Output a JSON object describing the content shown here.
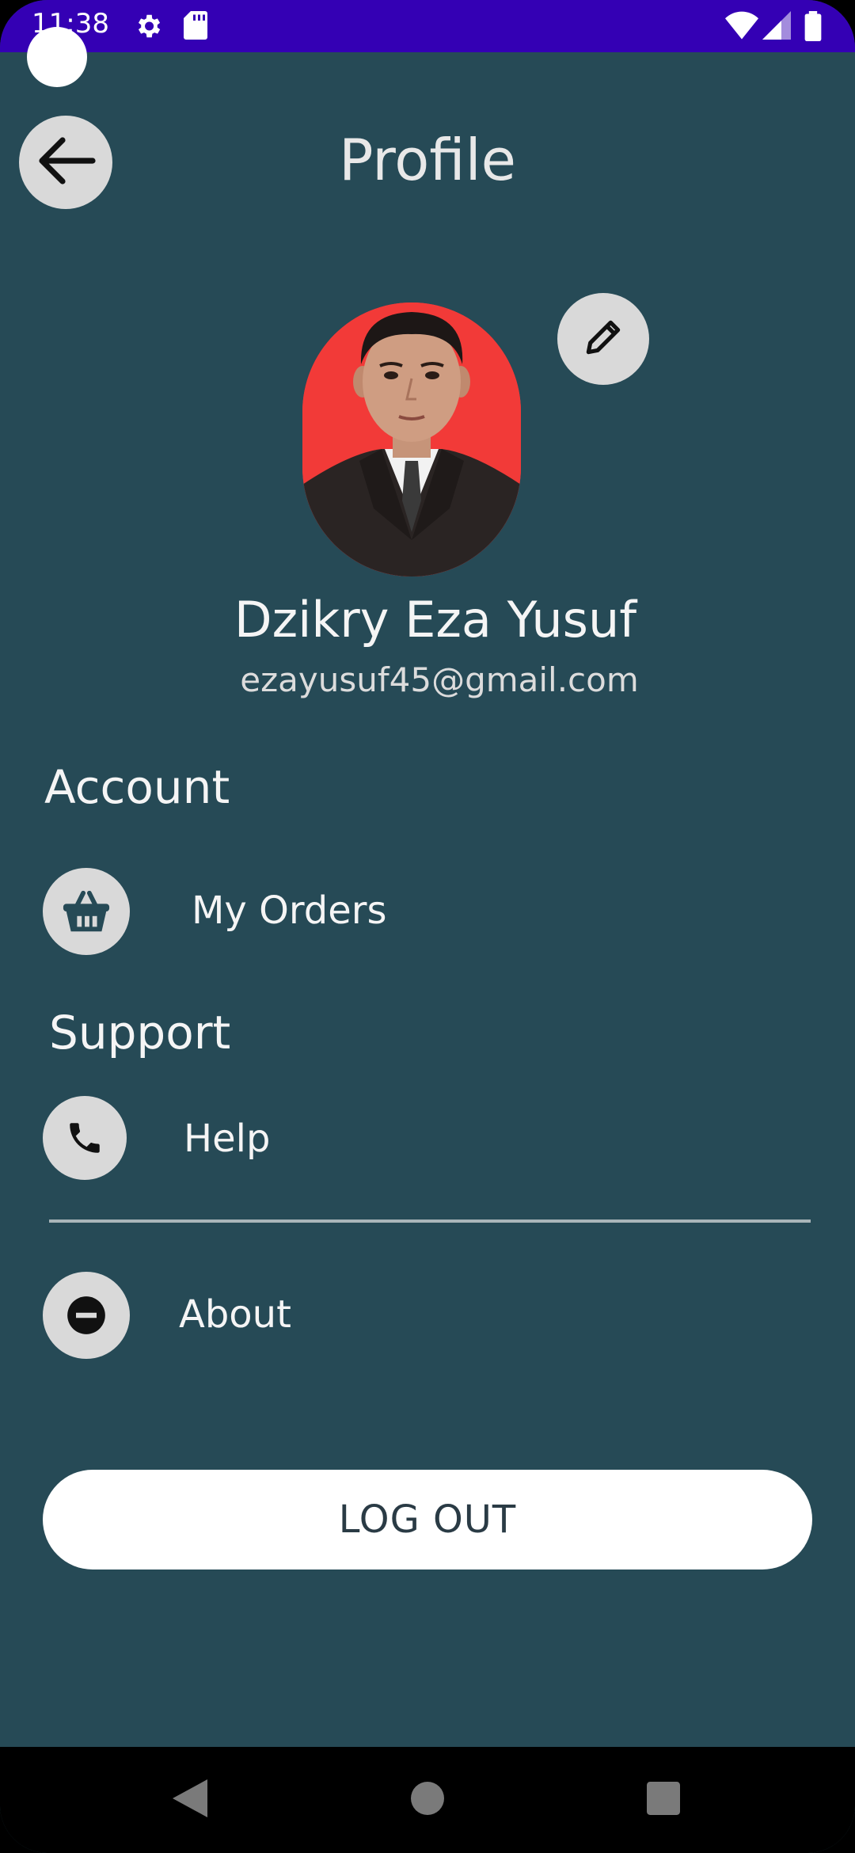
{
  "status_bar": {
    "time": "11:38",
    "icons": [
      "settings-icon",
      "sd-card-icon",
      "wifi-icon",
      "signal-icon",
      "battery-icon"
    ]
  },
  "header": {
    "title": "Profile",
    "back_icon": "arrow-left-icon"
  },
  "profile": {
    "name": "Dzikry Eza Yusuf",
    "email": "ezayusuf45@gmail.com",
    "edit_icon": "pencil-icon"
  },
  "sections": {
    "account": {
      "title": "Account",
      "items": [
        {
          "label": "My Orders",
          "icon": "basket-icon"
        }
      ]
    },
    "support": {
      "title": "Support",
      "items": [
        {
          "label": "Help",
          "icon": "phone-icon"
        },
        {
          "label": "About",
          "icon": "minus-circle-icon"
        }
      ]
    }
  },
  "logout": {
    "label": "LOG OUT"
  },
  "colors": {
    "background": "#264a56",
    "status_bar": "#3400b4",
    "icon_bg": "#d9d9d9",
    "avatar_bg": "#f23a38",
    "button_bg": "#ffffff",
    "button_text": "#2a3b45"
  }
}
